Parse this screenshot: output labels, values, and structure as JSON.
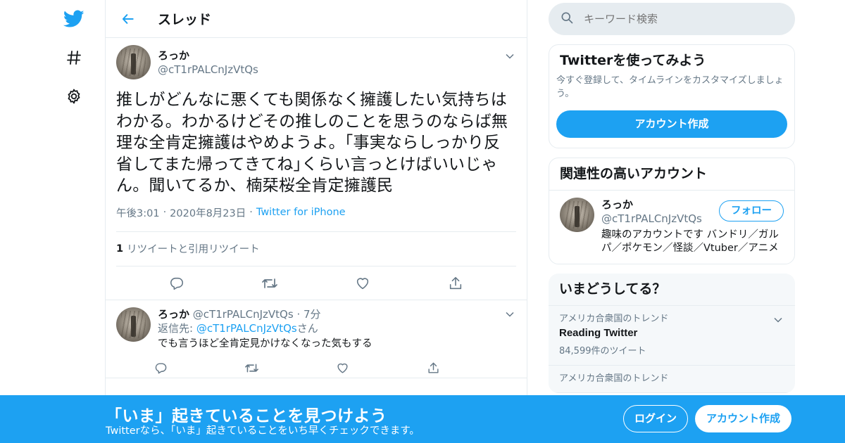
{
  "nav": {
    "icons": [
      "twitter-bird-icon",
      "hashtag-icon",
      "gear-icon"
    ]
  },
  "header": {
    "title": "スレッド"
  },
  "tweet": {
    "display_name": "ろっか",
    "handle": "@cT1rPALCnJzVtQs",
    "text": "推しがどんなに悪くても関係なく擁護したい気持ちはわかる。わかるけどその推しのことを思うのならば無理な全肯定擁護はやめようよ。「事実ならしっかり反省してまた帰ってきてね｣くらい言っとけばいいじゃん。聞いてるか、楠栞桜全肯定擁護民",
    "time": "午後3:01",
    "date": "2020年8月23日",
    "separator": "·",
    "source": "Twitter for iPhone",
    "retweet_count": "1",
    "retweet_label": "リツイートと引用リツイート"
  },
  "reply": {
    "display_name": "ろっか",
    "handle": "@cT1rPALCnJzVtQs",
    "time": "7分",
    "separator": "·",
    "reply_to_prefix": "返信先: ",
    "reply_to_handle": "@cT1rPALCnJzVtQs",
    "reply_to_suffix": "さん",
    "text": "でも言うほど全肯定見かけなくなった気もする"
  },
  "search": {
    "placeholder": "キーワード検索"
  },
  "signup_card": {
    "title": "Twitterを使ってみよう",
    "subtitle": "今すぐ登録して、タイムラインをカスタマイズしましょう。",
    "button": "アカウント作成"
  },
  "related": {
    "title": "関連性の高いアカウント",
    "display_name": "ろっか",
    "handle": "@cT1rPALCnJzVtQs",
    "follow": "フォロー",
    "bio": "趣味のアカウントです バンドリ／ガルパ／ポケモン／怪談／Vtuber／アニメ"
  },
  "trends": {
    "title": "いまどうしてる？",
    "items": [
      {
        "location": "アメリカ合衆国のトレンド",
        "name": "Reading Twitter",
        "count": "84,599件のツイート"
      },
      {
        "location": "アメリカ合衆国のトレンド",
        "name": "",
        "count": ""
      }
    ]
  },
  "banner": {
    "title": "「いま」起きていることを見つけよう",
    "subtitle": "Twitterなら、「いま」起きていることをいち早くチェックできます。",
    "login": "ログイン",
    "signup": "アカウント作成"
  },
  "colors": {
    "accent": "#1da1f2",
    "secondary_text": "#657786",
    "border": "#e6ecf0"
  }
}
